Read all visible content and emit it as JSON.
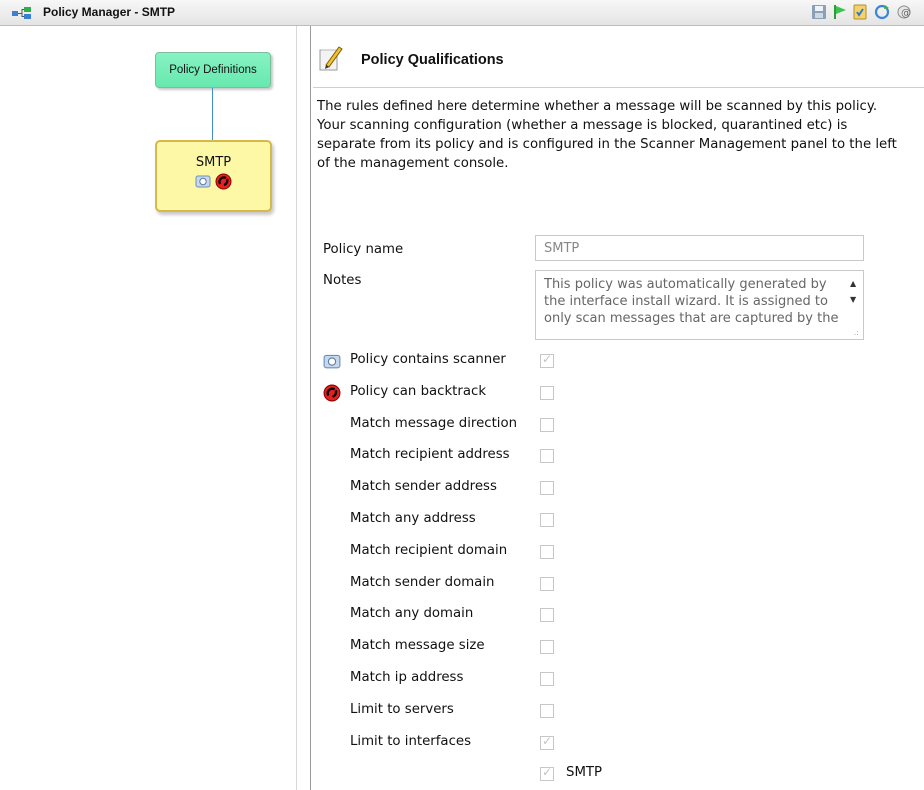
{
  "window": {
    "title": "Policy Manager - SMTP"
  },
  "toolbar": {
    "icons": [
      "save-icon",
      "flag-icon",
      "checklist-icon",
      "refresh-icon",
      "help-icon"
    ]
  },
  "tree": {
    "root_label": "Policy Definitions",
    "node_label": "SMTP",
    "node_icons": [
      "scanner-icon",
      "backtrack-icon"
    ]
  },
  "panel": {
    "heading": "Policy Qualifications",
    "description": "The rules defined here determine whether a message will be scanned by this policy.\nYour scanning configuration (whether a message is blocked, quarantined etc) is\nseparate from its policy and is configured in the Scanner Management panel to the left\nof the management console."
  },
  "form": {
    "policy_name_label": "Policy name",
    "policy_name_value": "SMTP",
    "notes_label": "Notes",
    "notes_value": "This policy was automatically generated by the interface install wizard.  It is assigned to only scan messages that are captured by the"
  },
  "options": [
    {
      "label": "Policy contains scanner",
      "checked": true,
      "icon": "scanner-icon"
    },
    {
      "label": "Policy can backtrack",
      "checked": false,
      "icon": "backtrack-icon"
    },
    {
      "label": "Match message direction",
      "checked": false
    },
    {
      "label": "Match recipient address",
      "checked": false
    },
    {
      "label": "Match sender address",
      "checked": false
    },
    {
      "label": "Match any address",
      "checked": false
    },
    {
      "label": "Match recipient domain",
      "checked": false
    },
    {
      "label": "Match sender domain",
      "checked": false
    },
    {
      "label": "Match any domain",
      "checked": false
    },
    {
      "label": "Match message size",
      "checked": false
    },
    {
      "label": "Match ip address",
      "checked": false
    },
    {
      "label": "Limit to servers",
      "checked": false
    },
    {
      "label": "Limit to interfaces",
      "checked": true
    }
  ],
  "interfaces": [
    {
      "label": "SMTP",
      "checked": true
    }
  ]
}
